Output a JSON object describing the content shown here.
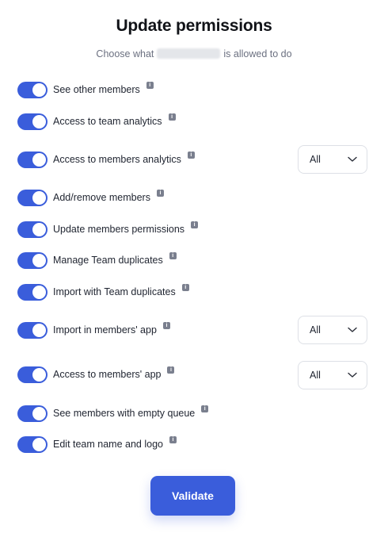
{
  "dialog": {
    "title": "Update permissions",
    "subtitle_prefix": "Choose what",
    "subtitle_suffix": "is allowed to do"
  },
  "permissions": [
    {
      "label": "See other members",
      "enabled": true
    },
    {
      "label": "Access to team analytics",
      "enabled": true
    },
    {
      "label": "Access to members analytics",
      "enabled": true,
      "select_value": "All"
    },
    {
      "label": "Add/remove members",
      "enabled": true
    },
    {
      "label": "Update members permissions",
      "enabled": true
    },
    {
      "label": "Manage Team duplicates",
      "enabled": true
    },
    {
      "label": "Import with Team duplicates",
      "enabled": true
    },
    {
      "label": "Import in members' app",
      "enabled": true,
      "select_value": "All"
    },
    {
      "label": "Access to members' app",
      "enabled": true,
      "select_value": "All"
    },
    {
      "label": "See members with empty queue",
      "enabled": true
    },
    {
      "label": "Edit team name and logo",
      "enabled": true
    }
  ],
  "info_icon": "i",
  "validate_label": "Validate",
  "colors": {
    "accent": "#3a5ddb",
    "info": "#7a7f8e"
  }
}
